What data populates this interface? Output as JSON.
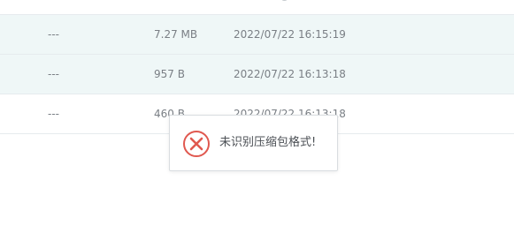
{
  "file_list": {
    "rows": [
      {
        "name": "---",
        "size": "7.27 MB",
        "modified": "2022/07/22 16:15:19",
        "selected": true
      },
      {
        "name": "---",
        "size": "957 B",
        "modified": "2022/07/22 16:13:18",
        "selected": true
      },
      {
        "name": "---",
        "size": "460 B",
        "modified": "2022/07/22 16:13:18",
        "selected": false
      }
    ]
  },
  "toast": {
    "icon": "error-circle-icon",
    "message": "未识别压缩包格式!",
    "accent_color": "#e0584f"
  }
}
